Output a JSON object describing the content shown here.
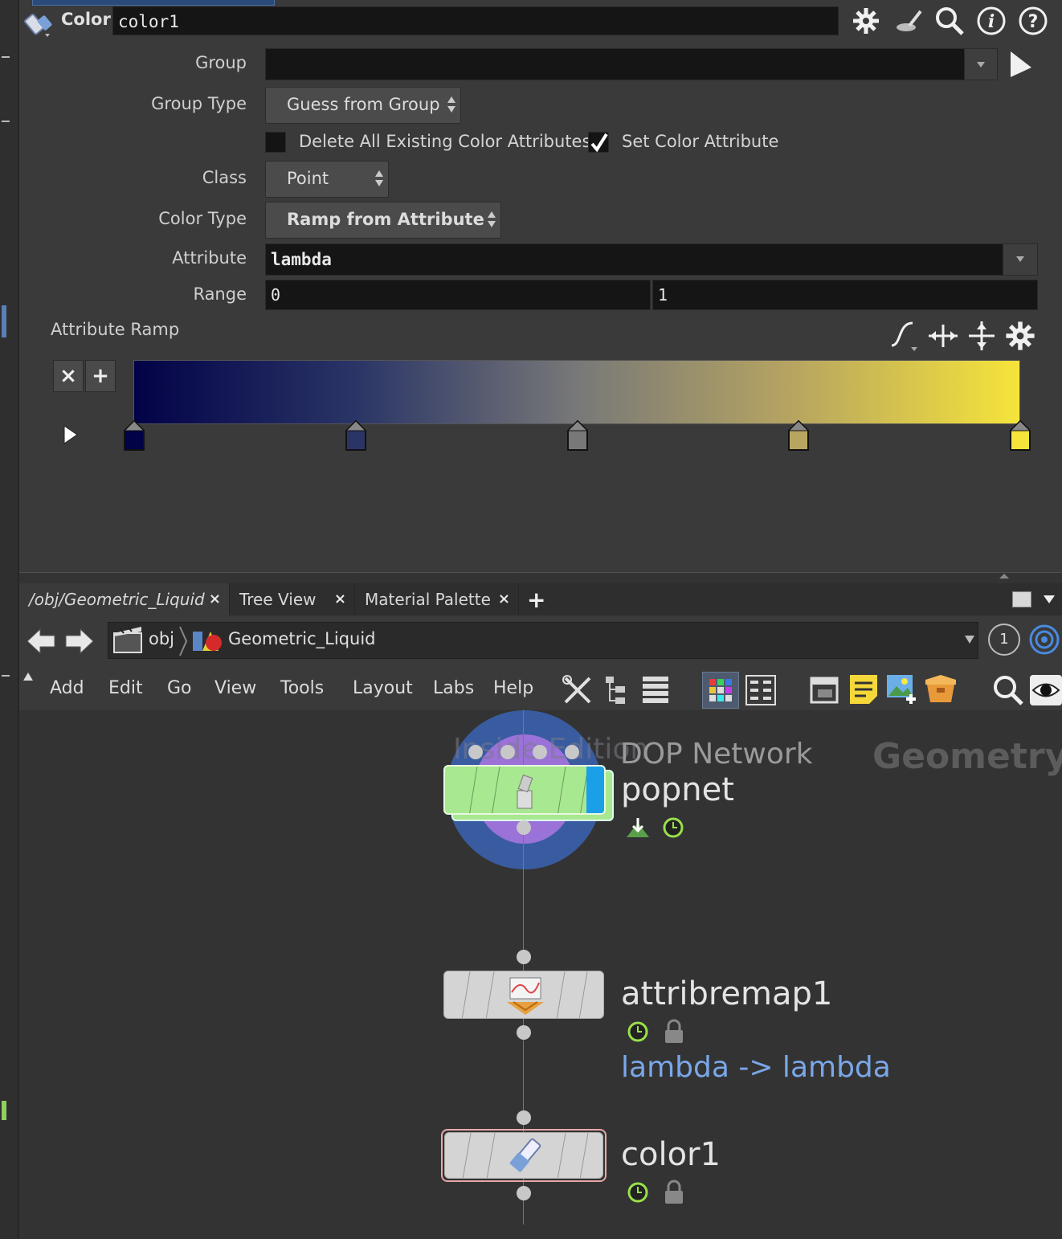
{
  "header": {
    "node_type_label": "Color",
    "node_name": "color1"
  },
  "params": {
    "group_label": "Group",
    "group_value": "",
    "group_type_label": "Group Type",
    "group_type_value": "Guess from Group",
    "delete_all_label": "Delete All Existing Color Attributes",
    "delete_all_checked": false,
    "set_color_label": "Set Color Attribute",
    "set_color_checked": true,
    "class_label": "Class",
    "class_value": "Point",
    "color_type_label": "Color Type",
    "color_type_value": "Ramp from Attribute",
    "attribute_label": "Attribute",
    "attribute_value": "lambda",
    "range_label": "Range",
    "range_min": "0",
    "range_max": "1",
    "ramp_label": "Attribute Ramp",
    "ramp_keys": [
      {
        "pos": 0.0,
        "color": "#020247"
      },
      {
        "pos": 0.25,
        "color": "#2a3566"
      },
      {
        "pos": 0.5,
        "color": "#787878"
      },
      {
        "pos": 0.75,
        "color": "#b8a660"
      },
      {
        "pos": 1.0,
        "color": "#f6e43a"
      }
    ]
  },
  "tabs": [
    {
      "label": "/obj/Geometric_Liquid"
    },
    {
      "label": "Tree View"
    },
    {
      "label": "Material Palette"
    }
  ],
  "path": {
    "root": "obj",
    "current": "Geometric_Liquid",
    "desktop_number": "1"
  },
  "menu": [
    "Add",
    "Edit",
    "Go",
    "View",
    "Tools",
    "Layout",
    "Labs",
    "Help"
  ],
  "network": {
    "context_label": "Geometry",
    "nodes": [
      {
        "name": "popnet",
        "type": "DOP Network",
        "faded_label": "Inside Edition"
      },
      {
        "name": "attribremap1",
        "comment": "lambda -> lambda"
      },
      {
        "name": "color1"
      }
    ]
  },
  "colors": {
    "popnet_body": "#a8e890",
    "popnet_flag": "#1aa0e8",
    "selected_outline": "#e8a8a8",
    "comment": "#7aa7e8"
  }
}
